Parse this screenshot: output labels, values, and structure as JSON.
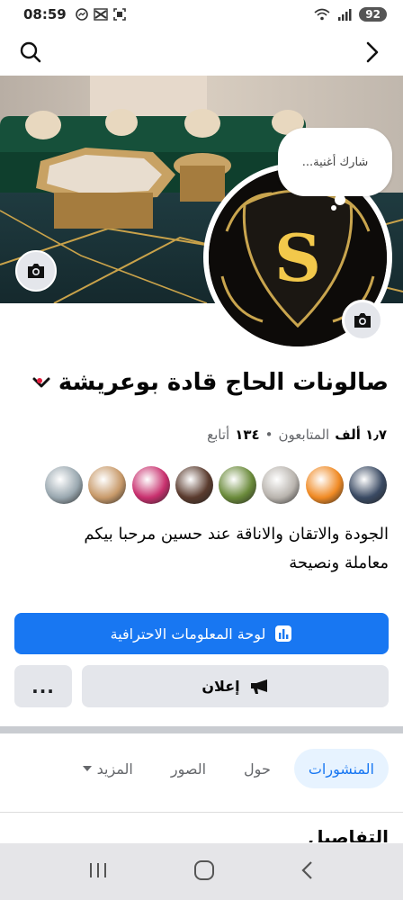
{
  "status_bar": {
    "time": "08:59",
    "battery": "92",
    "icons": [
      "messenger-icon",
      "capcut-icon",
      "scan-icon",
      "wifi-icon",
      "signal-icon"
    ]
  },
  "top_nav": {
    "search_icon": "search-icon",
    "back_icon": "chevron-right-icon"
  },
  "song_prompt": "شارك أغنية...",
  "avatar": {
    "letter": "S"
  },
  "page": {
    "name": "صالونات الحاج قادة بوعريشة",
    "followers_count": "١٫٧ ألف",
    "followers_label": "المتابعون",
    "following_count": "١٣٤",
    "following_label": "أتابع",
    "separator": "•",
    "bio_line1": "الجودة والاتقان والاناقة عند حسين مرحبا بيكم",
    "bio_line2": "معاملة ونصيحة"
  },
  "follower_avatars": [
    {
      "color": "#3a4a63"
    },
    {
      "color": "#f08a24"
    },
    {
      "color": "#b9b4ae"
    },
    {
      "color": "#6a8a3a"
    },
    {
      "color": "#5a3b2e"
    },
    {
      "color": "#c8306e"
    },
    {
      "color": "#c89a6a"
    },
    {
      "color": "#9aa8b0"
    }
  ],
  "buttons": {
    "dashboard": "لوحة المعلومات الاحترافية",
    "advertise": "إعلان",
    "more": "..."
  },
  "tabs": [
    {
      "label": "المنشورات",
      "active": true
    },
    {
      "label": "حول",
      "active": false
    },
    {
      "label": "الصور",
      "active": false
    },
    {
      "label": "المزيد",
      "active": false
    }
  ],
  "section_title": "التفاصيل",
  "colors": {
    "primary": "#1877f2",
    "tab_active_bg": "#e7f3ff",
    "button_gray": "#e4e6eb"
  }
}
